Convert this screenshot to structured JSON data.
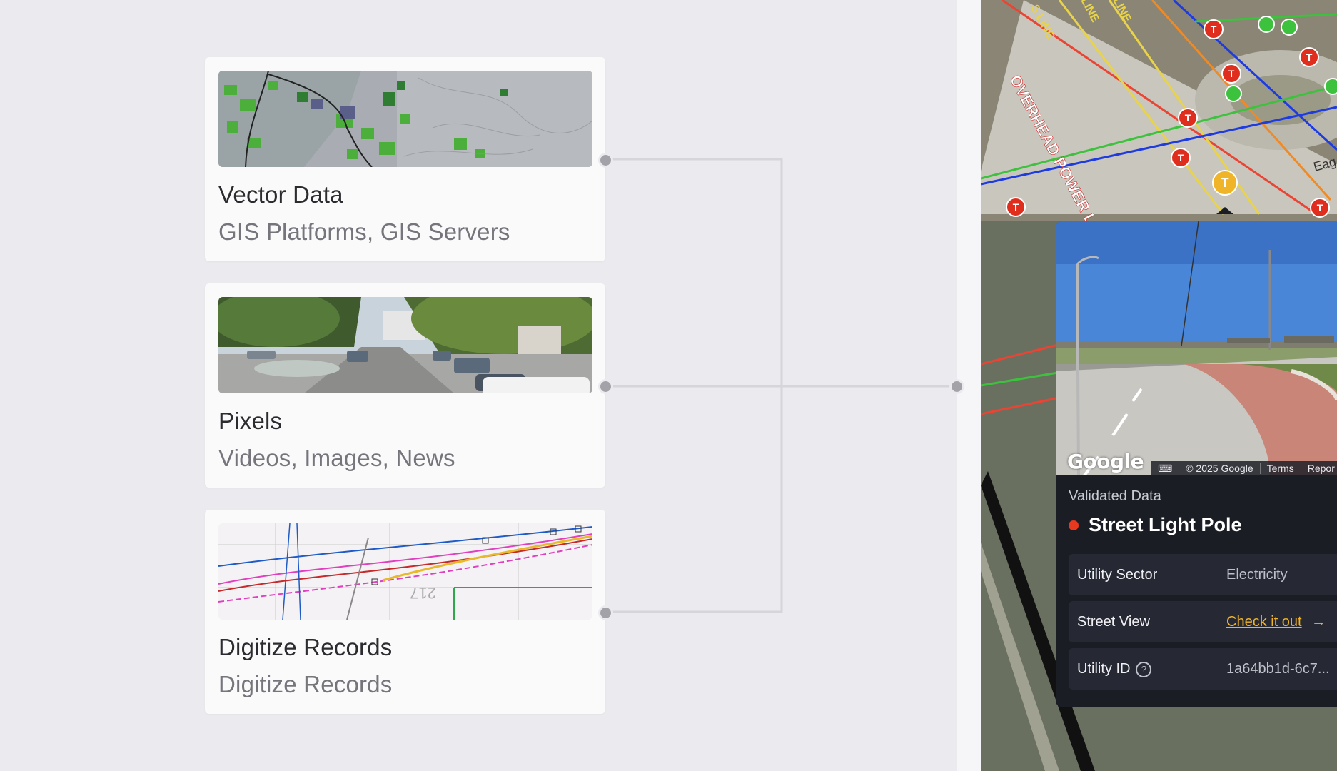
{
  "cards": [
    {
      "title": "Vector Data",
      "subtitle": "GIS Platforms, GIS Servers",
      "thumb": "satellite-imagery"
    },
    {
      "title": "Pixels",
      "subtitle": "Videos, Images, News",
      "thumb": "street-photo"
    },
    {
      "title": "Digitize Records",
      "subtitle": "Digitize Records",
      "thumb": "utility-drawing"
    }
  ],
  "map": {
    "labels": {
      "overhead": "OVERHEAD POWER LI",
      "line1": "S LINE",
      "line2": "LINE",
      "line3": "LINE",
      "street": "Eag"
    }
  },
  "panel": {
    "google_logo": "Google",
    "attribution": {
      "copyright": "© 2025 Google",
      "terms": "Terms",
      "report": "Repor"
    },
    "validated_label": "Validated Data",
    "feature_title": "Street Light Pole",
    "rows": [
      {
        "key": "Utility Sector",
        "value": "Electricity"
      },
      {
        "key": "Street View",
        "value": "Check it out",
        "arrow": "→"
      },
      {
        "key": "Utility ID",
        "value": "1a64bb1d-6c7...",
        "help": "?"
      }
    ]
  },
  "colors": {
    "background": "#ebeaee",
    "card": "#fafafb",
    "connector": "#d6d5da",
    "panel": "#1b1d25",
    "accent_link": "#f0b429",
    "status_red": "#e7391f"
  }
}
